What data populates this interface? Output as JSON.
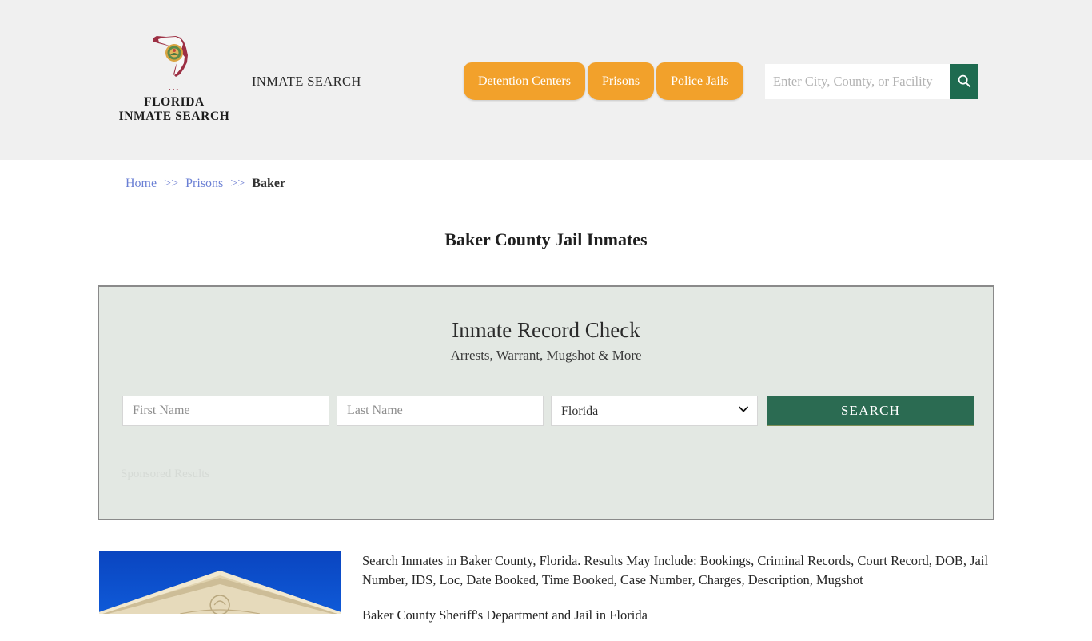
{
  "header": {
    "brand": {
      "line1": "FLORIDA",
      "line2": "INMATE SEARCH",
      "dots": "•••",
      "logo_icon": "florida-state-map-icon"
    },
    "tagline": "INMATE SEARCH",
    "nav_tabs": [
      {
        "label": "Detention Centers"
      },
      {
        "label": "Prisons"
      },
      {
        "label": "Police Jails"
      }
    ],
    "search": {
      "placeholder": "Enter City, County, or Facility",
      "value": "",
      "button_icon": "search-icon"
    },
    "colors": {
      "background": "#f0f0f0",
      "tab": "#f2a12b",
      "search_button": "#1e6b50",
      "accent_red": "#9c2f43"
    }
  },
  "breadcrumb": {
    "home": "Home",
    "sep": ">>",
    "section": "Prisons",
    "current": "Baker"
  },
  "page": {
    "title": "Baker County Jail Inmates"
  },
  "record_panel": {
    "title": "Inmate Record Check",
    "subtitle": "Arrests, Warrant, Mugshot & More",
    "first_name": {
      "placeholder": "First Name",
      "value": ""
    },
    "last_name": {
      "placeholder": "Last Name",
      "value": ""
    },
    "state": {
      "selected": "Florida",
      "caret_icon": "chevron-down-icon"
    },
    "search_button": "SEARCH",
    "sponsored_label": "Sponsored Results",
    "colors": {
      "panel_bg": "#e3e8e3",
      "panel_border": "#8a8a8a",
      "button_bg": "#2b6b52"
    }
  },
  "content": {
    "thumbnail_alt": "Baker County courthouse pediment",
    "paragraph1": "Search Inmates in Baker County, Florida. Results May Include: Bookings, Criminal Records, Court Record, DOB, Jail Number, IDS, Loc, Date Booked, Time Booked, Case Number, Charges, Description, Mugshot",
    "paragraph2": "Baker County Sheriff's Department and Jail in Florida"
  }
}
